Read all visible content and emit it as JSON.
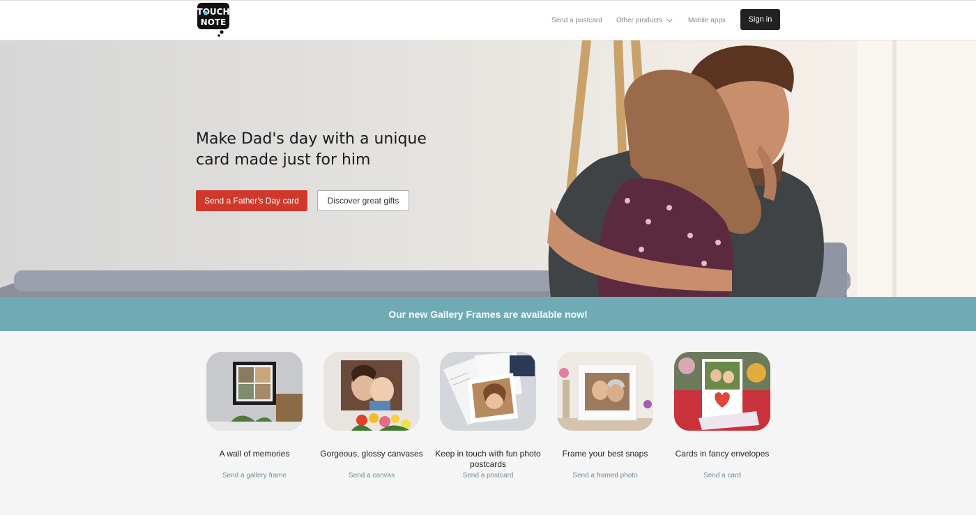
{
  "header": {
    "logo_text": "TOUCH NOTE",
    "nav": {
      "send_postcard": "Send a postcard",
      "other_products": "Other products",
      "mobile_apps": "Mobile apps"
    },
    "sign_in": "Sign in"
  },
  "hero": {
    "title": "Make Dad's day with a unique card made just for him",
    "primary_button": "Send a Father's Day card",
    "secondary_button": "Discover great gifts"
  },
  "banner": {
    "text": "Our new Gallery Frames are available now!"
  },
  "products": [
    {
      "title": "A wall of memories",
      "link": "Send a gallery frame"
    },
    {
      "title": "Gorgeous, glossy canvases",
      "link": "Send a canvas"
    },
    {
      "title": "Keep in touch with fun photo postcards",
      "link": "Send a postcard"
    },
    {
      "title": "Frame your best snaps",
      "link": "Send a framed photo"
    },
    {
      "title": "Cards in fancy envelopes",
      "link": "Send a card"
    }
  ],
  "colors": {
    "primary_red": "#d0382b",
    "banner_teal": "#70aab5",
    "dark": "#222222"
  }
}
